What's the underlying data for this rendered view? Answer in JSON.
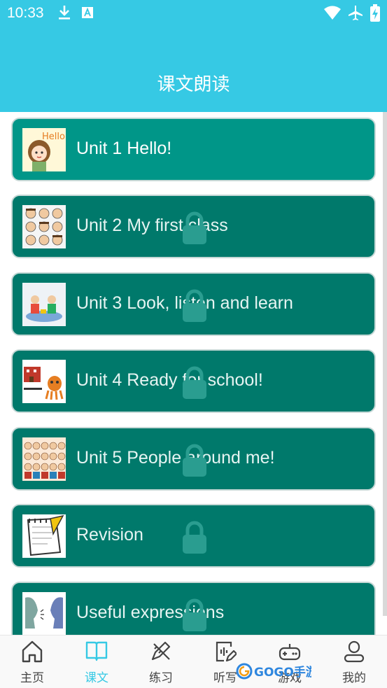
{
  "status_bar": {
    "time": "10:33",
    "icons": [
      "download-icon",
      "text-a-icon",
      "wifi-icon",
      "airplane-icon",
      "battery-charging-icon"
    ]
  },
  "header": {
    "title": "课文朗读"
  },
  "units": [
    {
      "label": "Unit 1 Hello!",
      "thumbnail": "hello-girl-icon",
      "locked": false
    },
    {
      "label": "Unit 2 My first class",
      "thumbnail": "faces-grid-icon",
      "locked": true
    },
    {
      "label": "Unit 3 Look, listen and learn",
      "thumbnail": "kids-playing-icon",
      "locked": true
    },
    {
      "label": "Unit 4 Ready for school!",
      "thumbnail": "school-octopus-icon",
      "locked": true
    },
    {
      "label": "Unit 5 People around me!",
      "thumbnail": "crowd-icon",
      "locked": true
    },
    {
      "label": "Revision",
      "thumbnail": "notepad-icon",
      "locked": true
    },
    {
      "label": "Useful expressions",
      "thumbnail": "talking-faces-icon",
      "locked": true
    }
  ],
  "tabs": [
    {
      "label": "主页",
      "icon": "home-icon"
    },
    {
      "label": "课文",
      "icon": "book-icon",
      "selected": true
    },
    {
      "label": "练习",
      "icon": "pencil-ruler-icon"
    },
    {
      "label": "听写",
      "icon": "dictation-icon"
    },
    {
      "label": "游戏",
      "icon": "gamepad-icon"
    },
    {
      "label": "我的",
      "icon": "user-icon"
    }
  ],
  "watermark": {
    "text": "GOGO手游网"
  },
  "colors": {
    "brand": "#36c9e4",
    "card_active": "#009688",
    "card_locked": "#00796b",
    "lock": "#2a9d90"
  }
}
